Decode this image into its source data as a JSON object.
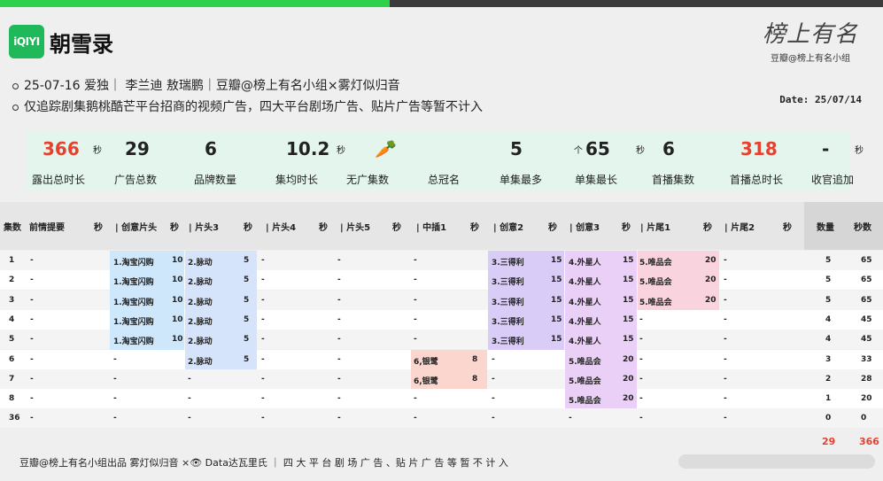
{
  "header": {
    "logo_text": "iQIYI",
    "title": "朝雪录",
    "brand_script": "榜上有名",
    "brand_sub": "豆瓣@榜上有名小组",
    "info_line1": "25-07-16 爱独｜ 李兰迪 敖瑞鹏｜豆瓣@榜上有名小组×雾灯似归音",
    "info_line2": "仅追踪剧集鹅桃酷芒平台招商的视频广告，四大平台剧场广告、贴片广告等暂不计入",
    "date": "Date: 25/07/14"
  },
  "stats": [
    {
      "value": "366",
      "unit": "秒",
      "label": "露出总时长",
      "red": true
    },
    {
      "value": "29",
      "unit": "",
      "label": "广告总数",
      "red": false
    },
    {
      "value": "6",
      "unit": "",
      "label": "品牌数量",
      "red": false
    },
    {
      "value": "10.2",
      "unit": "秒",
      "label": "集均时长",
      "red": false
    },
    {
      "value": "🥕",
      "unit": "",
      "label": "无广集数",
      "red": false
    },
    {
      "value": "",
      "unit": "",
      "label": "总冠名",
      "red": false
    },
    {
      "value": "5",
      "unit": "个",
      "label": "单集最多",
      "red": false
    },
    {
      "value": "65",
      "unit": "秒",
      "label": "单集最长",
      "red": false
    },
    {
      "value": "6",
      "unit": "",
      "label": "首播集数",
      "red": false
    },
    {
      "value": "318",
      "unit": "",
      "label": "首播总时长",
      "red": true
    },
    {
      "value": "-",
      "unit": "秒",
      "label": "收官追加",
      "red": false
    }
  ],
  "table": {
    "headers": [
      "集数",
      "前情提要",
      "秒",
      "| 创意片头",
      "秒",
      "| 片头3",
      "秒",
      "| 片头4",
      "秒",
      "| 片头5",
      "秒",
      "| 中插1",
      "秒",
      "| 创意2",
      "秒",
      "| 创意3",
      "秒",
      "| 片尾1",
      "秒",
      "| 片尾2",
      "秒",
      "数量",
      "秒数"
    ],
    "rows": [
      {
        "ep": "1",
        "prev": "-",
        "c1": "1.淘宝闪购",
        "c1s": "10",
        "c3": "2.脉动",
        "c3s": "5",
        "c4": "-",
        "c5": "-",
        "m1": "-",
        "m1s": "",
        "cr2": "3.三得利",
        "cr2s": "15",
        "cr3": "4.外星人",
        "cr3s": "15",
        "e1": "5.唯品会",
        "e1s": "20",
        "e2": "-",
        "n": "5",
        "sec": "65"
      },
      {
        "ep": "2",
        "prev": "-",
        "c1": "1.淘宝闪购",
        "c1s": "10",
        "c3": "2.脉动",
        "c3s": "5",
        "c4": "-",
        "c5": "-",
        "m1": "-",
        "m1s": "",
        "cr2": "3.三得利",
        "cr2s": "15",
        "cr3": "4.外星人",
        "cr3s": "15",
        "e1": "5.唯品会",
        "e1s": "20",
        "e2": "-",
        "n": "5",
        "sec": "65"
      },
      {
        "ep": "3",
        "prev": "-",
        "c1": "1.淘宝闪购",
        "c1s": "10",
        "c3": "2.脉动",
        "c3s": "5",
        "c4": "-",
        "c5": "-",
        "m1": "-",
        "m1s": "",
        "cr2": "3.三得利",
        "cr2s": "15",
        "cr3": "4.外星人",
        "cr3s": "15",
        "e1": "5.唯品会",
        "e1s": "20",
        "e2": "-",
        "n": "5",
        "sec": "65"
      },
      {
        "ep": "4",
        "prev": "-",
        "c1": "1.淘宝闪购",
        "c1s": "10",
        "c3": "2.脉动",
        "c3s": "5",
        "c4": "-",
        "c5": "-",
        "m1": "-",
        "m1s": "",
        "cr2": "3.三得利",
        "cr2s": "15",
        "cr3": "4.外星人",
        "cr3s": "15",
        "e1": "-",
        "e1s": "",
        "e2": "-",
        "n": "4",
        "sec": "45"
      },
      {
        "ep": "5",
        "prev": "-",
        "c1": "1.淘宝闪购",
        "c1s": "10",
        "c3": "2.脉动",
        "c3s": "5",
        "c4": "-",
        "c5": "-",
        "m1": "-",
        "m1s": "",
        "cr2": "3.三得利",
        "cr2s": "15",
        "cr3": "4.外星人",
        "cr3s": "15",
        "e1": "-",
        "e1s": "",
        "e2": "-",
        "n": "4",
        "sec": "45"
      },
      {
        "ep": "6",
        "prev": "-",
        "c1": "-",
        "c1s": "",
        "c3": "2.脉动",
        "c3s": "5",
        "c4": "-",
        "c5": "-",
        "m1": "6,银鹭",
        "m1s": "8",
        "cr2": "-",
        "cr2s": "",
        "cr3": "5.唯品会",
        "cr3s": "20",
        "e1": "-",
        "e1s": "",
        "e2": "-",
        "n": "3",
        "sec": "33"
      },
      {
        "ep": "7",
        "prev": "-",
        "c1": "-",
        "c1s": "",
        "c3": "-",
        "c3s": "",
        "c4": "-",
        "c5": "-",
        "m1": "6,银鹭",
        "m1s": "8",
        "cr2": "-",
        "cr2s": "",
        "cr3": "5.唯品会",
        "cr3s": "20",
        "e1": "-",
        "e1s": "",
        "e2": "-",
        "n": "2",
        "sec": "28"
      },
      {
        "ep": "8",
        "prev": "-",
        "c1": "-",
        "c1s": "",
        "c3": "-",
        "c3s": "",
        "c4": "-",
        "c5": "-",
        "m1": "-",
        "m1s": "",
        "cr2": "-",
        "cr2s": "",
        "cr3": "5.唯品会",
        "cr3s": "20",
        "e1": "-",
        "e1s": "",
        "e2": "-",
        "n": "1",
        "sec": "20"
      },
      {
        "ep": "36",
        "prev": "-",
        "c1": "-",
        "c1s": "",
        "c3": "-",
        "c3s": "",
        "c4": "-",
        "c5": "-",
        "m1": "-",
        "m1s": "",
        "cr2": "-",
        "cr2s": "",
        "cr3": "-",
        "cr3s": "",
        "e1": "-",
        "e1s": "",
        "e2": "-",
        "n": "0",
        "sec": "0"
      }
    ],
    "total_count": "29",
    "total_seconds": "366"
  },
  "footer": {
    "text": "豆瓣@榜上有名小组出品  雾灯似归音 ×👁 Data达瓦里氏 ｜ 四 大 平 台 剧 场 广 告 、贴 片 广 告 等 暂 不 计 入"
  },
  "colors": {
    "blue_cell": "#cfe7fb",
    "blue2_cell": "#d6e4fb",
    "purple_cell": "#d9ccf7",
    "violet_cell": "#ead0f7",
    "pink_cell": "#f9d3de",
    "salmon_cell": "#fbd6cf",
    "stat_bg": "#e3f5ed",
    "accent_red": "#e8402e"
  }
}
